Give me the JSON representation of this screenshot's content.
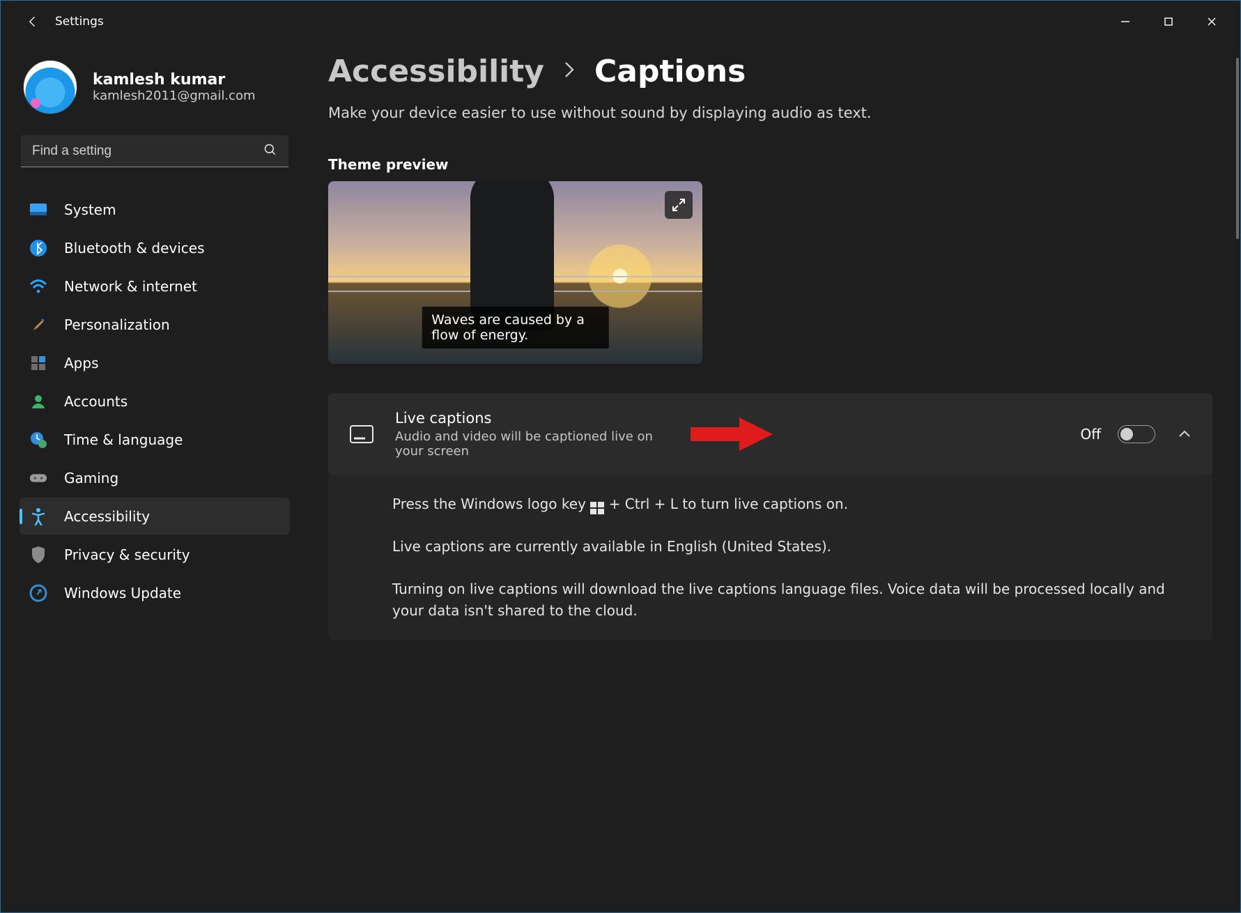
{
  "app": {
    "title": "Settings"
  },
  "profile": {
    "name": "kamlesh kumar",
    "email": "kamlesh2011@gmail.com"
  },
  "search": {
    "placeholder": "Find a setting"
  },
  "nav": {
    "items": [
      {
        "label": "System"
      },
      {
        "label": "Bluetooth & devices"
      },
      {
        "label": "Network & internet"
      },
      {
        "label": "Personalization"
      },
      {
        "label": "Apps"
      },
      {
        "label": "Accounts"
      },
      {
        "label": "Time & language"
      },
      {
        "label": "Gaming"
      },
      {
        "label": "Accessibility"
      },
      {
        "label": "Privacy & security"
      },
      {
        "label": "Windows Update"
      }
    ]
  },
  "breadcrumb": {
    "parent": "Accessibility",
    "current": "Captions"
  },
  "page": {
    "description": "Make your device easier to use without sound by displaying audio as text.",
    "theme_preview_label": "Theme preview",
    "theme_caption": "Waves are caused by a flow of energy."
  },
  "live_captions": {
    "title": "Live captions",
    "description": "Audio and video will be captioned live on your screen",
    "state_label": "Off",
    "info_line_1a": "Press the Windows logo key ",
    "info_line_1b": " + Ctrl + L to turn live captions on.",
    "info_line_2": "Live captions are currently available in English (United States).",
    "info_line_3": "Turning on live captions will download the live captions language files. Voice data will be processed locally and your data isn't shared to the cloud."
  }
}
